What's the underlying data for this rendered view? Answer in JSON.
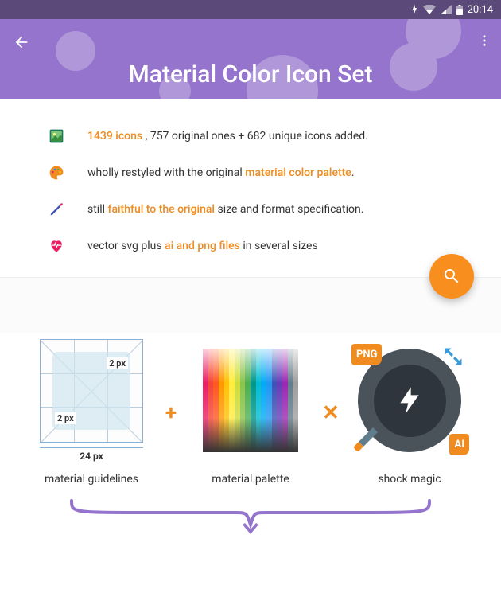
{
  "statusbar": {
    "time": "20:14"
  },
  "appbar": {
    "title": "Material Color Icon Set"
  },
  "features": [
    {
      "icon": "image",
      "parts": [
        {
          "text": "1439  icons",
          "em": true
        },
        {
          "text": " , 757 original ones + 682 unique icons added.",
          "em": false
        }
      ]
    },
    {
      "icon": "palette",
      "parts": [
        {
          "text": "wholly restyled with the original ",
          "em": false
        },
        {
          "text": "material color palette",
          "em": true
        },
        {
          "text": ".",
          "em": false
        }
      ]
    },
    {
      "icon": "pencil",
      "parts": [
        {
          "text": "still ",
          "em": false
        },
        {
          "text": "faithful to the original",
          "em": true
        },
        {
          "text": " size and format specification.",
          "em": false
        }
      ]
    },
    {
      "icon": "heart",
      "parts": [
        {
          "text": "vector svg plus ",
          "em": false
        },
        {
          "text": "ai and png files",
          "em": true
        },
        {
          "text": " in several sizes",
          "em": false
        }
      ]
    }
  ],
  "trio": {
    "op1": "+",
    "op2": "✕",
    "guidelines": {
      "label_2px_top": "2 px",
      "label_2px_bottom": "2 px",
      "label_24px": "24 px",
      "caption": "material guidelines"
    },
    "palette": {
      "caption": "material palette",
      "colors": [
        "#e91e63",
        "#f44336",
        "#ff5722",
        "#ff9800",
        "#ffc107",
        "#ffeb3b",
        "#cddc39",
        "#8bc34a",
        "#4caf50",
        "#009688",
        "#00bcd4",
        "#03a9f4",
        "#2196f3",
        "#3f51b5",
        "#673ab7",
        "#9c27b0",
        "#607d8b",
        "#9e9e9e"
      ]
    },
    "magic": {
      "png_badge": "PNG",
      "ai_badge": "AI",
      "caption": "shock magic"
    }
  }
}
